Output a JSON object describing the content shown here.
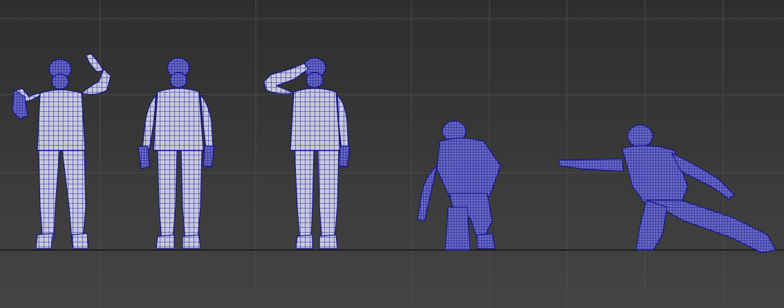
{
  "viewport": {
    "name": "perspective-viewport",
    "colors": {
      "background_top": "#2e2e2e",
      "background_bottom": "#444444",
      "grid_line": "#4f4f4f",
      "ground_line": "#111111",
      "wire_color": "#1a1a9e",
      "surface_fill": "#c8c8d8"
    },
    "grid": true
  },
  "models": [
    {
      "name": "soldier-waving",
      "pose": "waving"
    },
    {
      "name": "soldier-standing",
      "pose": "standing"
    },
    {
      "name": "soldier-saluting",
      "pose": "saluting"
    },
    {
      "name": "soldier-kneeling",
      "pose": "kneeling"
    },
    {
      "name": "soldier-lunging",
      "pose": "lunging-pointing"
    }
  ]
}
